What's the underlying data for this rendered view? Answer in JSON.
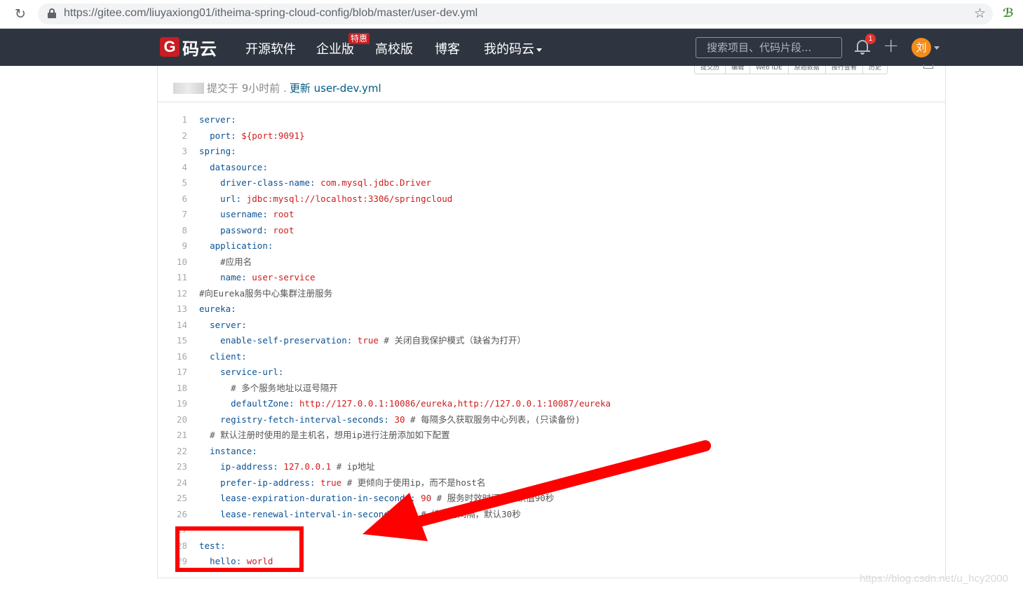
{
  "browser": {
    "url": "https://gitee.com/liuyaxiong01/itheima-spring-cloud-config/blob/master/user-dev.yml",
    "reload_glyph": "↻",
    "star_glyph": "☆",
    "ext_glyph": "ℬ"
  },
  "nav": {
    "logo_mark": "G",
    "logo_text": "码云",
    "items": [
      "开源软件",
      "企业版",
      "高校版",
      "博客",
      "我的码云"
    ],
    "badge": "特惠",
    "search_placeholder": "搜索项目、代码片段...",
    "notification_count": "1",
    "plus_glyph": "+",
    "avatar_text": "刘"
  },
  "file": {
    "title_partial": "user-dev.yml",
    "toolbar": [
      "提交历",
      "编辑",
      "Web IDE",
      "原始数据",
      "按行查看",
      "历史"
    ],
    "commit_meta": "提交于 9小时前 .",
    "commit_message": "更新 user-dev.yml"
  },
  "code_lines": [
    {
      "n": "1",
      "indent": "",
      "key": "server:",
      "val": "",
      "comment": ""
    },
    {
      "n": "2",
      "indent": "  ",
      "key": "port:",
      "val": " ${port:9091}",
      "comment": ""
    },
    {
      "n": "3",
      "indent": "",
      "key": "spring:",
      "val": "",
      "comment": ""
    },
    {
      "n": "4",
      "indent": "  ",
      "key": "datasource:",
      "val": "",
      "comment": ""
    },
    {
      "n": "5",
      "indent": "    ",
      "key": "driver-class-name:",
      "val": " com.mysql.jdbc.Driver",
      "comment": ""
    },
    {
      "n": "6",
      "indent": "    ",
      "key": "url:",
      "val": " jdbc:mysql://localhost:3306/springcloud",
      "comment": ""
    },
    {
      "n": "7",
      "indent": "    ",
      "key": "username:",
      "val": " root",
      "comment": ""
    },
    {
      "n": "8",
      "indent": "    ",
      "key": "password:",
      "val": " root",
      "comment": ""
    },
    {
      "n": "9",
      "indent": "  ",
      "key": "application:",
      "val": "",
      "comment": ""
    },
    {
      "n": "10",
      "indent": "    ",
      "key": "",
      "val": "",
      "comment": "#应用名"
    },
    {
      "n": "11",
      "indent": "    ",
      "key": "name:",
      "val": " user-service",
      "comment": ""
    },
    {
      "n": "12",
      "indent": "",
      "key": "",
      "val": "",
      "comment": "#向Eureka服务中心集群注册服务"
    },
    {
      "n": "13",
      "indent": "",
      "key": "eureka:",
      "val": "",
      "comment": ""
    },
    {
      "n": "14",
      "indent": "  ",
      "key": "server:",
      "val": "",
      "comment": ""
    },
    {
      "n": "15",
      "indent": "    ",
      "key": "enable-self-preservation:",
      "val": " true",
      "comment": " # 关闭自我保护模式（缺省为打开）"
    },
    {
      "n": "16",
      "indent": "  ",
      "key": "client:",
      "val": "",
      "comment": ""
    },
    {
      "n": "17",
      "indent": "    ",
      "key": "service-url:",
      "val": "",
      "comment": ""
    },
    {
      "n": "18",
      "indent": "      ",
      "key": "",
      "val": "",
      "comment": "# 多个服务地址以逗号隔开"
    },
    {
      "n": "19",
      "indent": "      ",
      "key": "defaultZone:",
      "val": " http://127.0.0.1:10086/eureka,http://127.0.0.1:10087/eureka",
      "comment": ""
    },
    {
      "n": "20",
      "indent": "    ",
      "key": "registry-fetch-interval-seconds:",
      "val": " 30",
      "comment": " # 每隔多久获取服务中心列表，(只读备份)"
    },
    {
      "n": "21",
      "indent": "  ",
      "key": "",
      "val": "",
      "comment": "# 默认注册时使用的是主机名，想用ip进行注册添加如下配置"
    },
    {
      "n": "22",
      "indent": "  ",
      "key": "instance:",
      "val": "",
      "comment": ""
    },
    {
      "n": "23",
      "indent": "    ",
      "key": "ip-address:",
      "val": " 127.0.0.1",
      "comment": " # ip地址"
    },
    {
      "n": "24",
      "indent": "    ",
      "key": "prefer-ip-address:",
      "val": " true",
      "comment": " # 更倾向于使用ip，而不是host名"
    },
    {
      "n": "25",
      "indent": "    ",
      "key": "lease-expiration-duration-in-seconds:",
      "val": " 90",
      "comment": " # 服务时效时间，默认值90秒"
    },
    {
      "n": "26",
      "indent": "    ",
      "key": "lease-renewal-interval-in-seconds:",
      "val": " 30",
      "comment": " # 续约的间隔，默认30秒"
    },
    {
      "n": "27",
      "indent": "",
      "key": "",
      "val": "",
      "comment": ""
    },
    {
      "n": "28",
      "indent": "",
      "key": "test:",
      "val": "",
      "comment": ""
    },
    {
      "n": "29",
      "indent": "  ",
      "key": "hello:",
      "val": " world",
      "comment": ""
    }
  ],
  "annotation": {
    "color": "#ff0000"
  },
  "watermark": "https://blog.csdn.net/u_hcy2000"
}
